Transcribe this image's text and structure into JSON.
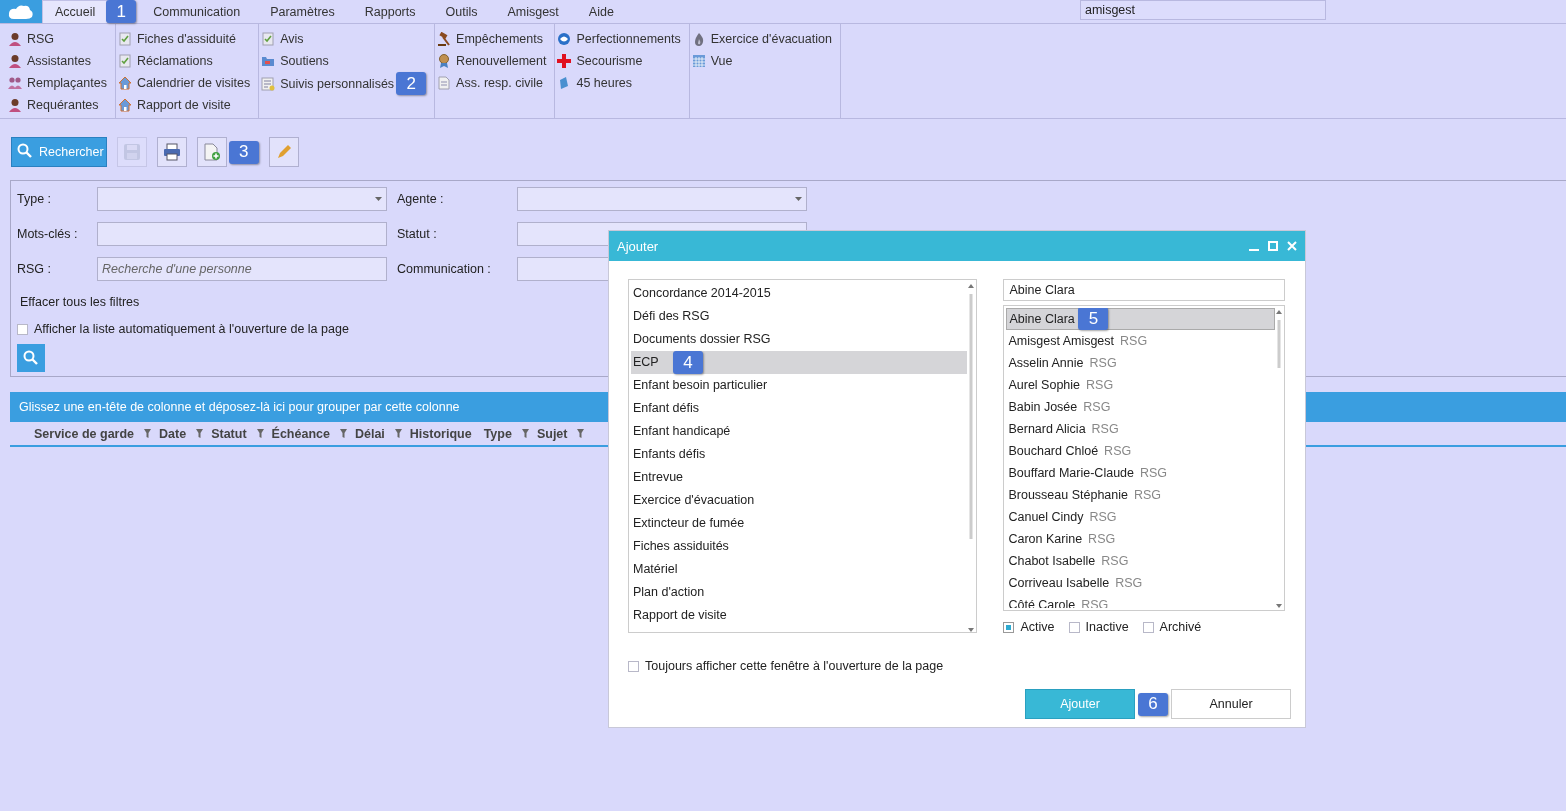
{
  "menu": {
    "items": [
      {
        "label": "Accueil",
        "selected": true,
        "callout": "1"
      },
      {
        "label": "Communication",
        "selected": false
      },
      {
        "label": "Paramètres",
        "selected": false
      },
      {
        "label": "Rapports",
        "selected": false
      },
      {
        "label": "Outils",
        "selected": false
      },
      {
        "label": "Amisgest",
        "selected": false
      },
      {
        "label": "Aide",
        "selected": false
      }
    ],
    "user_field": {
      "value": "amisgest"
    }
  },
  "ribbon": {
    "groups": [
      {
        "items": [
          {
            "label": "RSG"
          },
          {
            "label": "Assistantes"
          },
          {
            "label": "Remplaçantes"
          },
          {
            "label": "Requérantes"
          }
        ]
      },
      {
        "items": [
          {
            "label": "Fiches d'assiduité"
          },
          {
            "label": "Réclamations"
          },
          {
            "label": "Calendrier de visites"
          },
          {
            "label": "Rapport de visite"
          }
        ]
      },
      {
        "items": [
          {
            "label": "Avis"
          },
          {
            "label": "Soutiens"
          },
          {
            "label": "Suivis personnalisés",
            "callout": "2"
          }
        ]
      },
      {
        "items": [
          {
            "label": "Empêchements"
          },
          {
            "label": "Renouvellement"
          },
          {
            "label": "Ass. resp. civile"
          }
        ]
      },
      {
        "items": [
          {
            "label": "Perfectionnements"
          },
          {
            "label": "Secourisme"
          },
          {
            "label": "45 heures"
          }
        ]
      },
      {
        "items": [
          {
            "label": "Exercice d'évacuation"
          },
          {
            "label": "Vue"
          }
        ]
      }
    ]
  },
  "toolbar": {
    "buttons": [
      {
        "kind": "search",
        "label": "Rechercher",
        "disabled": false
      },
      {
        "kind": "save",
        "disabled": true
      },
      {
        "kind": "print",
        "disabled": false
      },
      {
        "kind": "new",
        "disabled": false,
        "callout": "3"
      },
      {
        "kind": "edit",
        "disabled": false
      }
    ]
  },
  "filters": {
    "fields": [
      {
        "label": "Type :",
        "kind": "dropdown"
      },
      {
        "label": "Agente :",
        "kind": "dropdown"
      },
      {
        "label": "Mots-clés :",
        "kind": "text"
      },
      {
        "label": "Statut :",
        "kind": "dropdown"
      },
      {
        "label": "RSG :",
        "kind": "text",
        "placeholder": "Recherche d'une personne"
      },
      {
        "label": "Communication :",
        "kind": "text"
      }
    ],
    "clear_link": "Effacer tous les filtres",
    "auto_show": {
      "label": "Afficher la liste automatiquement à l'ouverture de la page",
      "checked": false
    }
  },
  "grid": {
    "group_hint": "Glissez une en-tête de colonne et déposez-là ici pour grouper par cette colonne",
    "columns": [
      {
        "label": "Service de garde",
        "filter": true
      },
      {
        "label": "Date",
        "filter": true
      },
      {
        "label": "Statut",
        "filter": true
      },
      {
        "label": "Échéance",
        "filter": true
      },
      {
        "label": "Délai",
        "filter": true
      },
      {
        "label": "Historique",
        "filter": false
      },
      {
        "label": "Type",
        "filter": true
      },
      {
        "label": "Sujet",
        "filter": true
      }
    ]
  },
  "dialog": {
    "title": "Ajouter",
    "types": [
      {
        "label": "Concordance 2014-2015",
        "selected": false
      },
      {
        "label": "Défi des RSG",
        "selected": false
      },
      {
        "label": "Documents dossier RSG",
        "selected": false
      },
      {
        "label": "ECP",
        "selected": true,
        "callout": "4"
      },
      {
        "label": "Enfant besoin particulier",
        "selected": false
      },
      {
        "label": "Enfant défis",
        "selected": false
      },
      {
        "label": "Enfant handicapé",
        "selected": false
      },
      {
        "label": "Enfants défis",
        "selected": false
      },
      {
        "label": "Entrevue",
        "selected": false
      },
      {
        "label": "Exercice d'évacuation",
        "selected": false
      },
      {
        "label": "Extincteur de fumée",
        "selected": false
      },
      {
        "label": "Fiches assiduités",
        "selected": false
      },
      {
        "label": "Matériel",
        "selected": false
      },
      {
        "label": "Plan d'action",
        "selected": false
      },
      {
        "label": "Rapport de visite",
        "selected": false
      }
    ],
    "person_search": {
      "value": "Abine Clara"
    },
    "people": [
      {
        "name": "Abine Clara",
        "selected": true,
        "callout": "5"
      },
      {
        "name": "Amisgest Amisgest",
        "tag": "RSG",
        "selected": false
      },
      {
        "name": "Asselin Annie",
        "tag": "RSG",
        "selected": false
      },
      {
        "name": "Aurel Sophie",
        "tag": "RSG",
        "selected": false
      },
      {
        "name": "Babin Josée",
        "tag": "RSG",
        "selected": false
      },
      {
        "name": "Bernard Alicia",
        "tag": "RSG",
        "selected": false
      },
      {
        "name": "Bouchard Chloé",
        "tag": "RSG",
        "selected": false
      },
      {
        "name": "Bouffard Marie-Claude",
        "tag": "RSG",
        "selected": false
      },
      {
        "name": "Brousseau Stéphanie",
        "tag": "RSG",
        "selected": false
      },
      {
        "name": "Canuel Cindy",
        "tag": "RSG",
        "selected": false
      },
      {
        "name": "Caron Karine",
        "tag": "RSG",
        "selected": false
      },
      {
        "name": "Chabot Isabelle",
        "tag": "RSG",
        "selected": false
      },
      {
        "name": "Corriveau Isabelle",
        "tag": "RSG",
        "selected": false
      },
      {
        "name": "Côté Carole",
        "tag": "RSG",
        "selected": false
      }
    ],
    "status_filters": [
      {
        "label": "Active",
        "checked": true
      },
      {
        "label": "Inactive",
        "checked": false
      },
      {
        "label": "Archivé",
        "checked": false
      }
    ],
    "always_show": {
      "label": "Toujours afficher cette fenêtre à l'ouverture de la page",
      "checked": false
    },
    "buttons": [
      {
        "kind": "primary",
        "label": "Ajouter",
        "callout": "6"
      },
      {
        "kind": "secondary",
        "label": "Annuler"
      }
    ]
  }
}
